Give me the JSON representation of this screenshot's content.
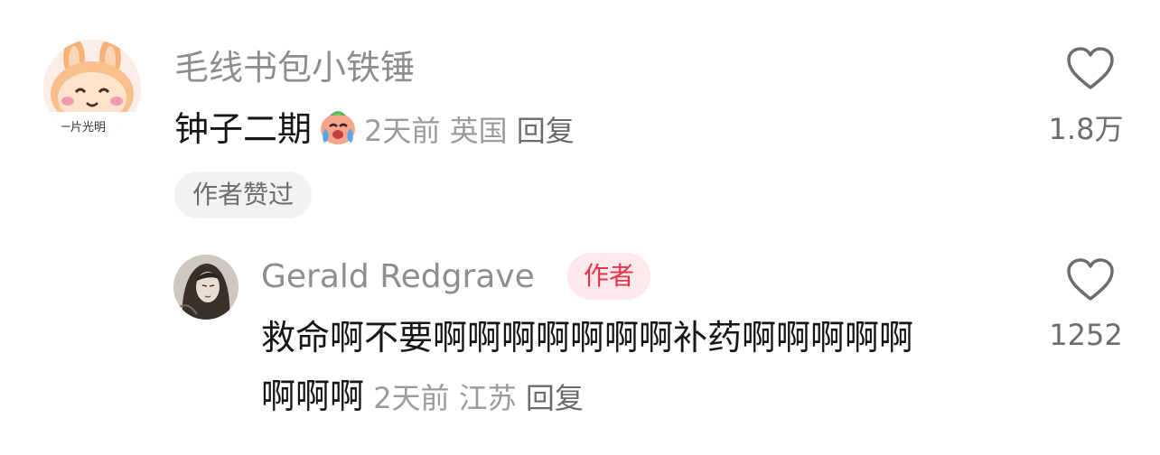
{
  "comment": {
    "avatar": {
      "icon": "bunny-sticker-avatar",
      "caption": "途一片光明"
    },
    "author": "毛线书包小铁锤",
    "text": "钟子二期",
    "emoji": "crying-face-emoji",
    "time": "2天前",
    "location": "英国",
    "reply_label": "回复",
    "liked_badge": "作者赞过",
    "likes": "1.8万",
    "like_icon": "heart-outline-icon"
  },
  "reply": {
    "avatar": {
      "icon": "portrait-avatar"
    },
    "author": "Gerald Redgrave",
    "author_tag": "作者",
    "text_line1": "救命啊不要啊啊啊啊啊啊啊补药啊啊啊啊啊",
    "text_line2": "啊啊啊",
    "time": "2天前",
    "location": "江苏",
    "reply_label": "回复",
    "likes": "1252",
    "like_icon": "heart-outline-icon"
  },
  "colors": {
    "author_tag_bg": "#fde9ec",
    "author_tag_text": "#e6334a",
    "badge_bg": "#f2f2f2"
  }
}
